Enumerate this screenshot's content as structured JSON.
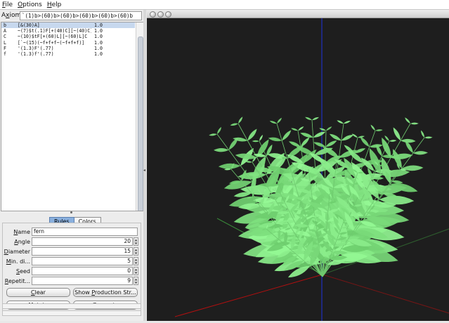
{
  "menu": [
    {
      "label": "File",
      "mnemonic": "F",
      "rest": "ile"
    },
    {
      "label": "Options",
      "mnemonic": "O",
      "rest": "ptions"
    },
    {
      "label": "Help",
      "mnemonic": "H",
      "rest": "elp"
    }
  ],
  "axiom": {
    "label_mnemonic": "x",
    "label_pre": "A",
    "label_post": "iom",
    "value": "`(1)b>(60)b>(60)b>(60)b>(60)b>(60)b"
  },
  "rules": [
    {
      "symbol": "b",
      "production": "[&(30)A]",
      "probability": "1.0",
      "selected": true
    },
    {
      "symbol": "A",
      "production": "~(7)$t(.1)F[+(40)C][~(40)C]!(...",
      "probability": "1.0"
    },
    {
      "symbol": "C",
      "production": "~(10)$tF[+(60)L][~(60)L]C",
      "probability": "1.0"
    },
    {
      "symbol": "L",
      "production": "[`~(15)(~f+f+f~(~f+f+f)]",
      "probability": "1.0"
    },
    {
      "symbol": "F",
      "production": "'(1.3)F'(.77)",
      "probability": "1.0"
    },
    {
      "symbol": "f",
      "production": "'(1.3)f'(.77)",
      "probability": "1.0"
    }
  ],
  "tabs": [
    {
      "label": "Rules",
      "active": true
    },
    {
      "label": "Colors",
      "active": false
    }
  ],
  "fields": {
    "name": {
      "mnemonic": "N",
      "rest": "ame",
      "value": "fern"
    },
    "angle": {
      "mnemonic": "A",
      "rest": "ngle",
      "value": "20"
    },
    "diameter": {
      "mnemonic": "D",
      "rest": "iameter",
      "value": "15"
    },
    "min_diameter": {
      "mnemonic": "M",
      "rest": "in. di...",
      "value": "5"
    },
    "seed": {
      "mnemonic": "S",
      "rest": "eed",
      "value": "0"
    },
    "repetitions": {
      "mnemonic": "R",
      "rest": "epetit...",
      "value": "9"
    }
  },
  "buttons": {
    "clear": {
      "mnemonic": "C",
      "rest": "lear"
    },
    "show_production": {
      "pre": "Show ",
      "mnemonic": "P",
      "rest": "roduction Str..."
    },
    "mutate": {
      "mnemonic": "M",
      "rest": "utate"
    },
    "generate": {
      "mnemonic": "G",
      "rest": "enerate"
    }
  },
  "colors": {
    "canvas": "#1e1e1e",
    "fern_dark": "#2f9a2f",
    "fern_light": "#8af08a",
    "axis_red": "#b01010",
    "axis_green": "#3a8a3a",
    "axis_blue": "#2030c0",
    "selected_row": "#c7d8ee",
    "active_tab": "#8ab0de"
  }
}
